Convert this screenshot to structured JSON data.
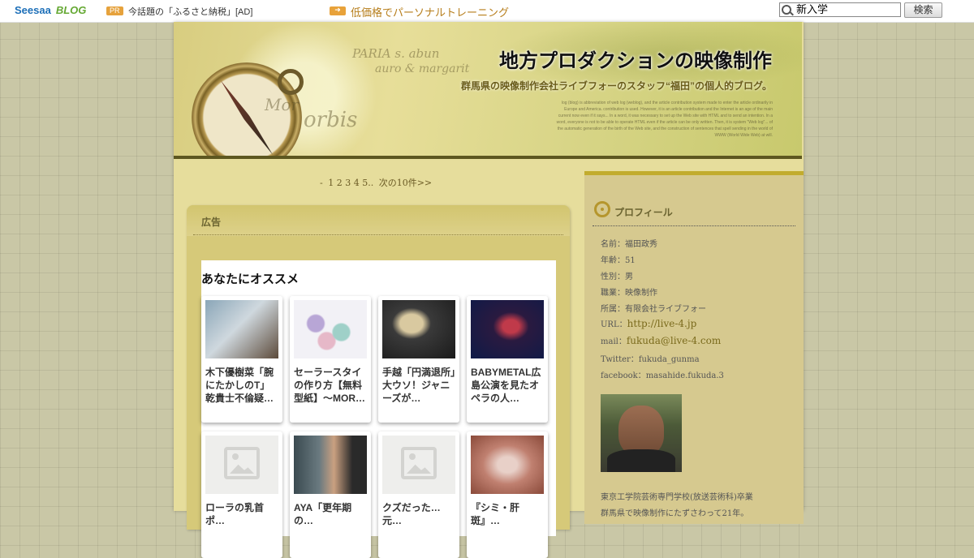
{
  "topbar": {
    "logo_main": "Seesaa",
    "logo_blog": "BLOG",
    "pr_badge": "PR",
    "pr_text": "今話題の「ふるさと納税」[AD]",
    "ad_link": "低価格でパーソナルトレーニング",
    "search_value": "新入学",
    "search_button": "検索"
  },
  "header": {
    "title": "地方プロダクションの映像制作",
    "subtitle": "群馬県の映像制作会社ライブフォーのスタッフ“福田”の個人的ブログ。",
    "fine_text": "log (blog) is abbreviation of web log (weblog), and the article contribution system made to enter the article ordinarily in Europe and America. contribution is used. However, it is an article contribution and the Internet is an age of the main current now even if it says... In a word, it was necessary to set up the Web site with HTML and to send an intention. In a word, everyone is not to be able to operate HTML even if the article can be only written. Then, it is system \"Web log\"... of the automatic generation of the birth of the Web site, and the construction of sentences that spell sending in the world of WWW (World Wide Web) at will.",
    "map_words": [
      "PARIA s. abun",
      "auro & margarit",
      "orbis",
      "Mor"
    ]
  },
  "pager": {
    "dash": "-",
    "pages": [
      "1",
      "2",
      "3",
      "4",
      "5"
    ],
    "ellipsis": "..",
    "next": "次の10件>>"
  },
  "ad_box": {
    "title": "広告",
    "recommend_title": "あなたにオススメ",
    "cards": [
      {
        "text": "木下優樹菜「腕にたかしのT」乾貴士不倫疑…",
        "thumb_color": "#6f8fa8"
      },
      {
        "text": "セーラースタイの作り方【無料型紙】〜MOR…",
        "thumb_color": "#e4e2ec"
      },
      {
        "text": "手越「円満退所」大ウソ！ジャニーズが…",
        "thumb_color": "#2c2c2c"
      },
      {
        "text": "BABYMETAL広島公演を見たオペラの人…",
        "thumb_color": "#1b2a5a"
      },
      {
        "text": "ローラの乳首ポ…",
        "thumb_color": "placeholder"
      },
      {
        "text": "AYA「更年期の…",
        "thumb_color": "#3c4c50"
      },
      {
        "text": "クズだった…元…",
        "thumb_color": "placeholder"
      },
      {
        "text": "『シミ・肝斑』…",
        "thumb_color": "#b06a5a"
      }
    ]
  },
  "profile": {
    "title": "プロフィール",
    "name_label": "名前：",
    "name": "福田政秀",
    "age_label": "年齢：",
    "age": "51",
    "sex_label": "性別：",
    "sex": "男",
    "job_label": "職業：",
    "job": "映像制作",
    "org_label": "所属：",
    "org": "有限会社ライブフォー",
    "url_label": "URL：",
    "url": "http://live-4.jp",
    "mail_label": "mail：",
    "mail": "fukuda@live-4.com",
    "twitter_label": "Twitter：",
    "twitter": "fukuda_gunma",
    "facebook_label": "facebook：",
    "facebook": "masahide.fukuda.3",
    "bio_1": "東京工学院芸術専門学校(放送芸術科)卒業",
    "bio_2": "群馬県で映像制作にたずさわって21年。"
  }
}
